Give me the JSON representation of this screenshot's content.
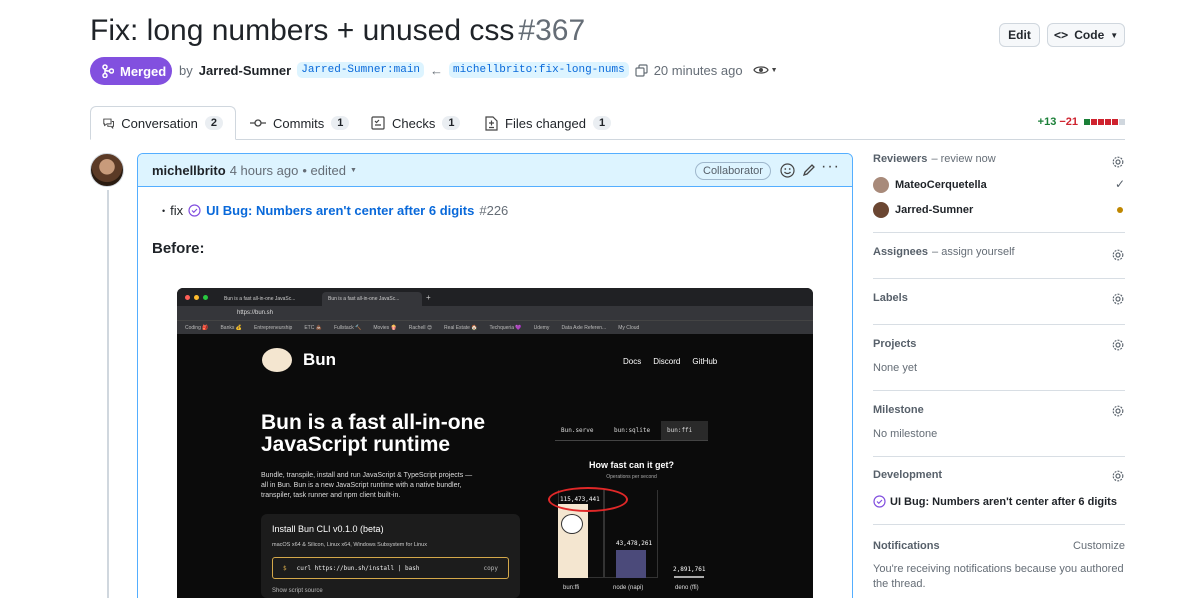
{
  "header": {
    "title": "Fix: long numbers + unused css",
    "number": "#367",
    "edit_label": "Edit",
    "code_label": "Code"
  },
  "status": {
    "state": "Merged",
    "by_label": "by",
    "author": "Jarred-Sumner",
    "base_branch": "Jarred-Sumner:main",
    "head_branch": "michellbrito:fix-long-nums",
    "time": "20 minutes ago"
  },
  "tabs": [
    {
      "label": "Conversation",
      "count": "2"
    },
    {
      "label": "Commits",
      "count": "1"
    },
    {
      "label": "Checks",
      "count": "1"
    },
    {
      "label": "Files changed",
      "count": "1"
    }
  ],
  "diffstat": {
    "added": "+13",
    "removed": "−21"
  },
  "comment": {
    "author": "michellbrito",
    "time": "4 hours ago",
    "edited": "• edited",
    "role": "Collaborator",
    "bullet_prefix": "fix",
    "issue_title": "UI Bug: Numbers aren't center after 6 digits",
    "issue_number": "#226",
    "before_label": "Before:"
  },
  "embedded_screenshot": {
    "tab1": "Bun is a fast all-in-one JavaSc...",
    "tab2": "Bun is a fast all-in-one JavaSc...",
    "url": "https://bun.sh",
    "bookmarks": [
      "Coding 🎒",
      "Banks 💰",
      "Entrepreneurship",
      "ETC 💩",
      "Fullstack 🔨",
      "Movies 🍿",
      "Rachell 😍",
      "Real Estate 🏠",
      "Techqueria 💜",
      "Udemy",
      "Data Axle Referen...",
      "My Cloud"
    ],
    "brand": "Bun",
    "nav": [
      "Docs",
      "Discord",
      "GitHub"
    ],
    "hero_line1": "Bun is a fast all-in-one",
    "hero_line2": "JavaScript runtime",
    "hero_desc_1": "Bundle, transpile, install and run JavaScript & TypeScript projects —",
    "hero_desc_2": "all in Bun. Bun is a new JavaScript runtime with a native bundler,",
    "hero_desc_3": "transpiler, task runner and npm client built-in.",
    "install_title": "Install Bun CLI v0.1.0 (beta)",
    "install_platforms": "macOS x64 & Silicon, Linux x64, Windows Subsystem for Linux",
    "install_prompt": "$",
    "install_cmd": "curl https://bun.sh/install | bash",
    "copy_label": "copy",
    "show_source": "Show script source",
    "bench_tabs": [
      "Bun.serve",
      "bun:sqlite",
      "bun:ffi"
    ],
    "bench_title": "How fast can it get?",
    "bench_sub": "Operations per second",
    "bench_values": [
      "115,473,441",
      "43,478,261",
      "2,891,761"
    ],
    "bench_labels": [
      "bun:ffi",
      "node (napi)",
      "deno (ffi)"
    ]
  },
  "sidebar": {
    "reviewers": {
      "title": "Reviewers",
      "sub": "– review now",
      "items": [
        "MateoCerquetella",
        "Jarred-Sumner"
      ]
    },
    "assignees": {
      "title": "Assignees",
      "sub": "– assign yourself"
    },
    "labels": {
      "title": "Labels"
    },
    "projects": {
      "title": "Projects",
      "value": "None yet"
    },
    "milestone": {
      "title": "Milestone",
      "value": "No milestone"
    },
    "development": {
      "title": "Development",
      "value": "UI Bug: Numbers aren't center after 6 digits"
    },
    "notifications": {
      "title": "Notifications",
      "action": "Customize",
      "text1": "You're receiving notifications because you authored",
      "text2": "the thread."
    }
  },
  "colors": {
    "merged": "#8250df",
    "link": "#0969da",
    "added": "#1a7f37",
    "removed": "#cf222e"
  }
}
